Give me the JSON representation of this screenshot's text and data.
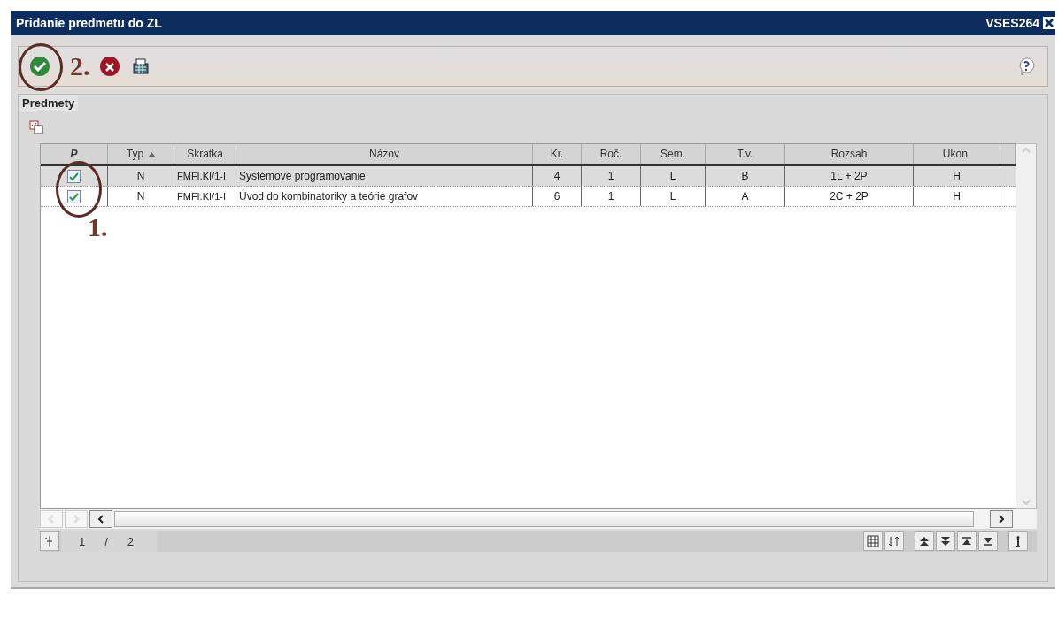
{
  "window": {
    "title": "Pridanie predmetu do ZL",
    "code": "VSES264"
  },
  "toolbar": {
    "annotation": "2."
  },
  "panel": {
    "title": "Predmety"
  },
  "table": {
    "check_column": {
      "label": "P"
    },
    "columns": [
      {
        "label": "Typ",
        "sorted": true
      },
      {
        "label": "Skratka",
        "sorted": false
      },
      {
        "label": "Názov",
        "sorted": false
      },
      {
        "label": "Kr.",
        "sorted": false
      },
      {
        "label": "Roč.",
        "sorted": false
      },
      {
        "label": "Sem.",
        "sorted": false
      },
      {
        "label": "T.v.",
        "sorted": false
      },
      {
        "label": "Rozsah",
        "sorted": false
      },
      {
        "label": "Ukon.",
        "sorted": false
      }
    ],
    "rows": [
      {
        "checked": true,
        "selected": true,
        "cells": [
          "N",
          "FMFI.KI/1-I",
          "Systémové programovanie",
          "4",
          "1",
          "L",
          "B",
          "1L + 2P",
          "H"
        ]
      },
      {
        "checked": true,
        "selected": false,
        "cells": [
          "N",
          "FMFI.KI/1-I",
          "Úvod do kombinatoriky a teórie grafov",
          "6",
          "1",
          "L",
          "A",
          "2C + 2P",
          "H"
        ]
      }
    ],
    "annotation": "1."
  },
  "pager": {
    "current": "1",
    "separator": "/",
    "total": "2"
  }
}
